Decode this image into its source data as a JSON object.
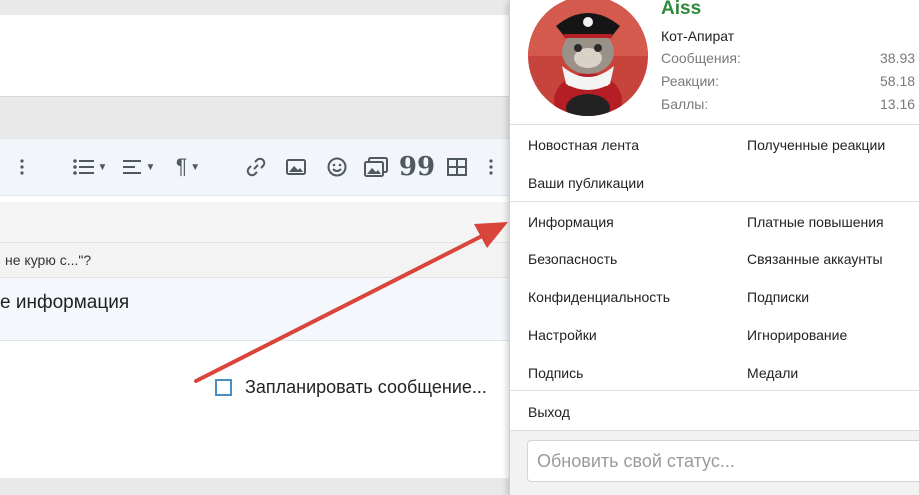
{
  "editor": {
    "quote_fragment": "не курю с...\"?",
    "info_fragment": "е информация",
    "schedule_label": "Запланировать сообщение..."
  },
  "account_menu": {
    "username": "Aiss",
    "user_title": "Кот-Апират",
    "stats": [
      {
        "label": "Сообщения:",
        "value": "38.93"
      },
      {
        "label": "Реакции:",
        "value": "58.18"
      },
      {
        "label": "Баллы:",
        "value": "13.16"
      }
    ],
    "links_left": [
      "Новостная лента",
      "Ваши публикации"
    ],
    "links_right_top": [
      "Полученные реакции"
    ],
    "account_left": [
      "Информация",
      "Безопасность",
      "Конфиденциальность",
      "Настройки",
      "Подпись"
    ],
    "account_right": [
      "Платные повышения",
      "Связанные аккаунты",
      "Подписки",
      "Игнорирование",
      "Медали"
    ],
    "logout": "Выход",
    "status_placeholder": "Обновить свой статус..."
  },
  "colors": {
    "username": "#2f8a3f",
    "arrow": "#d9453a",
    "checkbox": "#4a8ec8"
  }
}
